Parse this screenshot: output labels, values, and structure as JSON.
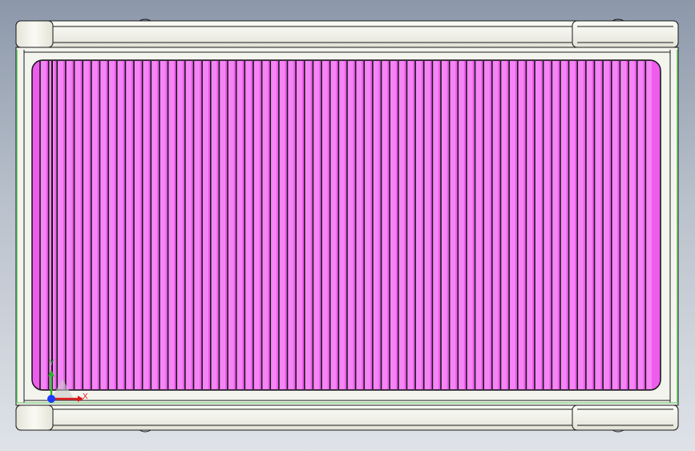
{
  "viewport": {
    "background_top": "#8c98aa",
    "background_bottom": "#dfe3e8"
  },
  "model": {
    "frame_color": "#f4f4ee",
    "edge_color": "#1a1a1a",
    "green_edge_color": "#5fc25f",
    "panel_color": "#ee5cee",
    "slat_color": "#f585f5",
    "groove_color": "#1a1a1a",
    "slat_count": 72
  },
  "triad": {
    "x_label": "X",
    "y_label": "Y",
    "x_color": "#e01818",
    "y_color": "#2ab52a",
    "z_color": "#1a3cff"
  }
}
